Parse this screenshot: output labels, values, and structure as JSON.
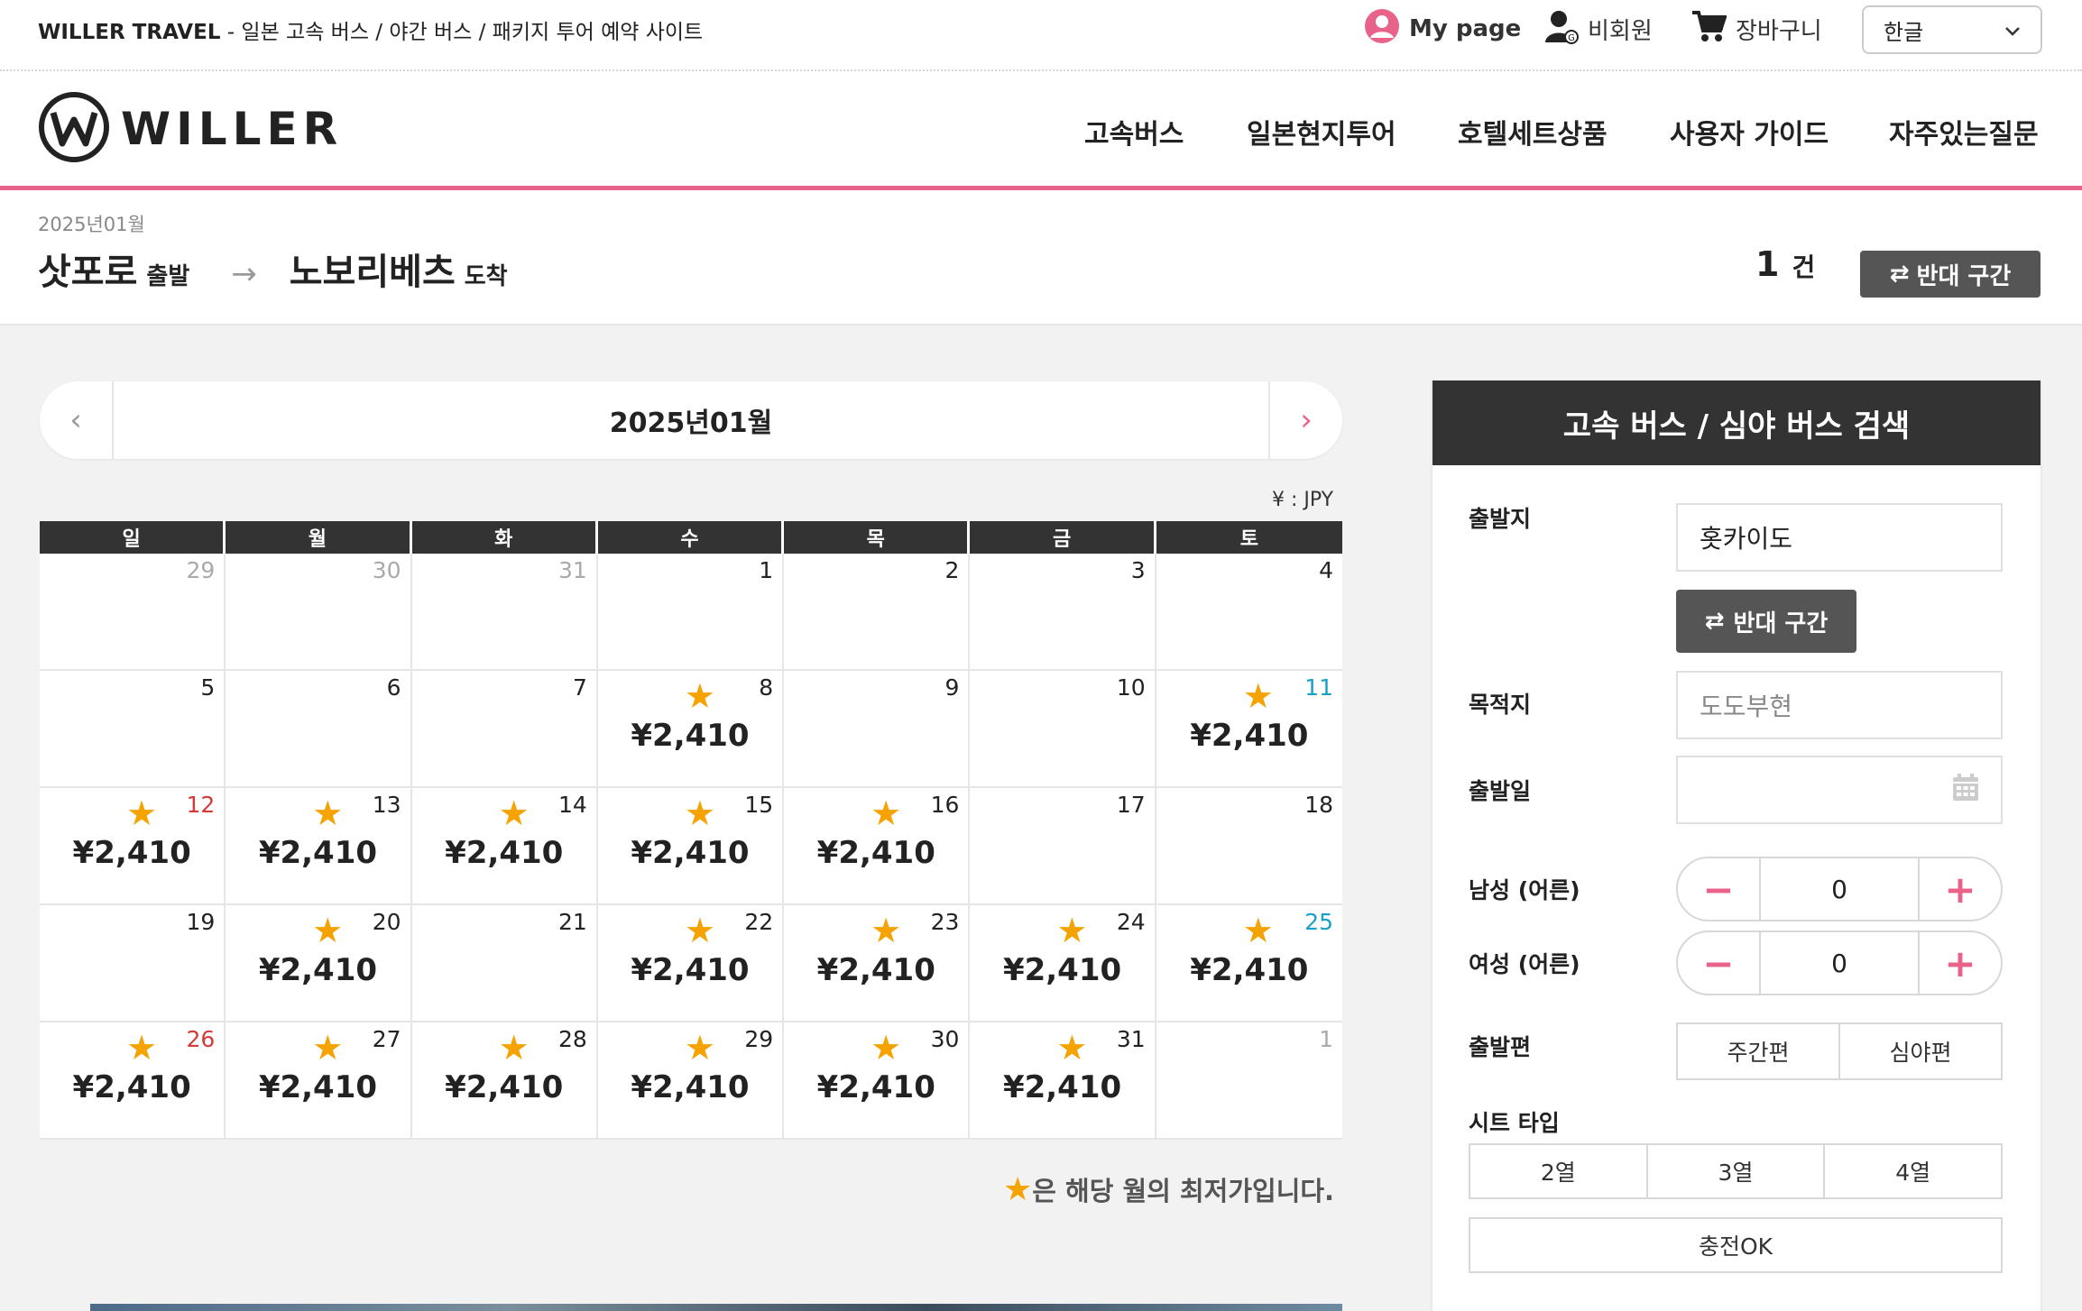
{
  "topbar": {
    "brand": "WILLER TRAVEL",
    "tagline": " - 일본 고속 버스 / 야간 버스 / 패키지 투어 예약 사이트",
    "mypage": "My page",
    "guest": "비회원",
    "cart": "장바구니",
    "language": "한글"
  },
  "header": {
    "logo_text": "WILLER",
    "nav": [
      "고속버스",
      "일본현지투어",
      "호텔세트상품",
      "사용자 가이드",
      "자주있는질문"
    ]
  },
  "route": {
    "month": "2025년01월",
    "from_city": "삿포로",
    "from_label": "출발",
    "to_city": "노보리베츠",
    "to_label": "도착",
    "count": "1",
    "count_unit": "건",
    "reverse_label": "반대 구간"
  },
  "calendar": {
    "title": "2025년01월",
    "currency_note": "¥ : JPY",
    "weekdays": [
      "일",
      "월",
      "화",
      "수",
      "목",
      "금",
      "토"
    ],
    "legend_star": "★",
    "legend_text": "은 해당 월의 최저가입니다.",
    "weeks": [
      [
        {
          "day": "29",
          "other": true
        },
        {
          "day": "30",
          "other": true
        },
        {
          "day": "31",
          "other": true
        },
        {
          "day": "1"
        },
        {
          "day": "2"
        },
        {
          "day": "3"
        },
        {
          "day": "4"
        }
      ],
      [
        {
          "day": "5"
        },
        {
          "day": "6"
        },
        {
          "day": "7"
        },
        {
          "day": "8",
          "price": "¥2,410",
          "star": true
        },
        {
          "day": "9"
        },
        {
          "day": "10"
        },
        {
          "day": "11",
          "price": "¥2,410",
          "star": true,
          "holiday": "sat"
        }
      ],
      [
        {
          "day": "12",
          "price": "¥2,410",
          "star": true,
          "holiday": "sun"
        },
        {
          "day": "13",
          "price": "¥2,410",
          "star": true
        },
        {
          "day": "14",
          "price": "¥2,410",
          "star": true
        },
        {
          "day": "15",
          "price": "¥2,410",
          "star": true
        },
        {
          "day": "16",
          "price": "¥2,410",
          "star": true
        },
        {
          "day": "17"
        },
        {
          "day": "18"
        }
      ],
      [
        {
          "day": "19"
        },
        {
          "day": "20",
          "price": "¥2,410",
          "star": true
        },
        {
          "day": "21"
        },
        {
          "day": "22",
          "price": "¥2,410",
          "star": true
        },
        {
          "day": "23",
          "price": "¥2,410",
          "star": true
        },
        {
          "day": "24",
          "price": "¥2,410",
          "star": true
        },
        {
          "day": "25",
          "price": "¥2,410",
          "star": true,
          "holiday": "sat"
        }
      ],
      [
        {
          "day": "26",
          "price": "¥2,410",
          "star": true,
          "holiday": "sun"
        },
        {
          "day": "27",
          "price": "¥2,410",
          "star": true
        },
        {
          "day": "28",
          "price": "¥2,410",
          "star": true
        },
        {
          "day": "29",
          "price": "¥2,410",
          "star": true
        },
        {
          "day": "30",
          "price": "¥2,410",
          "star": true
        },
        {
          "day": "31",
          "price": "¥2,410",
          "star": true
        },
        {
          "day": "1",
          "other": true
        }
      ]
    ]
  },
  "search": {
    "title": "고속 버스 / 심야 버스 검색",
    "origin_label": "출발지",
    "origin_value": "홋카이도",
    "reverse_label": "반대 구간",
    "destination_label": "목적지",
    "destination_placeholder": "도도부현",
    "date_label": "출발일",
    "male_label": "남성 (어른)",
    "male_value": "0",
    "female_label": "여성 (어른)",
    "female_value": "0",
    "departure_label": "출발편",
    "departure_options": [
      "주간편",
      "심야편"
    ],
    "seat_label": "시트 타입",
    "seat_options": [
      "2열",
      "3열",
      "4열"
    ],
    "charge_option": "충전OK"
  },
  "colors": {
    "accent": "#e8628a",
    "star": "#f5a300",
    "dark": "#333333",
    "sunday": "#d33a3a",
    "saturday": "#1aa0c8"
  }
}
